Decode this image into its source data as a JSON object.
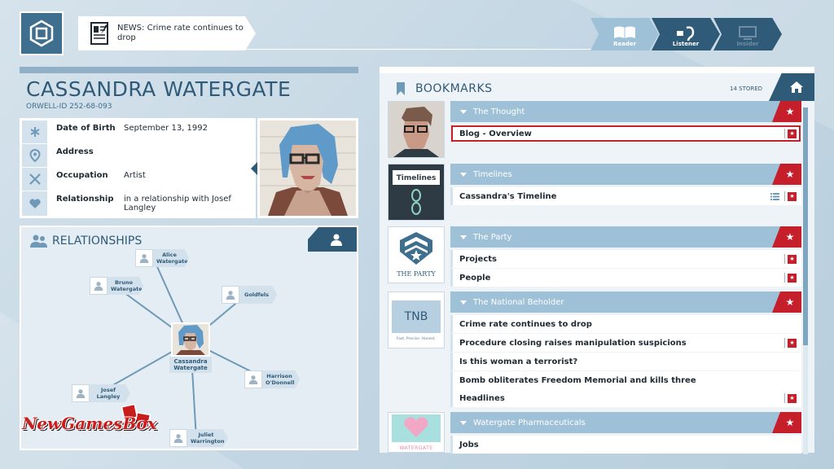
{
  "news": {
    "text": "NEWS: Crime rate continues to drop"
  },
  "modes": [
    {
      "label": "Reader",
      "active": true
    },
    {
      "label": "Listener",
      "active": false
    },
    {
      "label": "Insider",
      "active": false
    }
  ],
  "profile": {
    "name": "CASSANDRA WATERGATE",
    "id_label": "ORWELL-ID",
    "id_value": "252-68-093",
    "rows": [
      {
        "icon": "asterisk-icon",
        "label": "Date of Birth",
        "value": "September 13, 1992"
      },
      {
        "icon": "location-pin-icon",
        "label": "Address",
        "value": ""
      },
      {
        "icon": "tools-icon",
        "label": "Occupation",
        "value": "Artist"
      },
      {
        "icon": "heart-icon",
        "label": "Relationship",
        "value": "in a relationship with Josef Langley"
      }
    ]
  },
  "relationships": {
    "title": "RELATIONSHIPS",
    "center": {
      "name": "Cassandra Watergate"
    },
    "people": [
      {
        "name": "Alice Watergate"
      },
      {
        "name": "Bruno Watergate"
      },
      {
        "name": "Goldfels"
      },
      {
        "name": "Harrison O'Donnell"
      },
      {
        "name": "Josef Langley"
      },
      {
        "name": "Juliet Warrington"
      }
    ]
  },
  "watermark": {
    "text": "NewGamesBox"
  },
  "bookmarks": {
    "title": "BOOKMARKS",
    "stored": "14 STORED",
    "groups": [
      {
        "name": "The Thought",
        "items": [
          {
            "label": "Blog - Overview",
            "selected": true
          }
        ]
      },
      {
        "name": "Timelines",
        "thumb_label": "Timelines",
        "items": [
          {
            "label": "Cassandra's Timeline",
            "selected": false
          }
        ]
      },
      {
        "name": "The Party",
        "thumb_label": "THE PARTY",
        "items": [
          {
            "label": "Projects",
            "selected": false
          },
          {
            "label": "People",
            "selected": false
          }
        ]
      },
      {
        "name": "The National Beholder",
        "thumb_label": "TNB",
        "thumb_tagline": "Fast. Precise. Honest.",
        "items": [
          {
            "label": "Crime rate continues to drop",
            "selected": false
          },
          {
            "label": "Procedure closing raises manipulation suspicions",
            "selected": false
          },
          {
            "label": "Is this woman a terrorist?",
            "selected": false
          },
          {
            "label": "Bomb obliterates Freedom Memorial and kills three",
            "selected": false
          },
          {
            "label": "Headlines",
            "selected": false
          }
        ]
      },
      {
        "name": "Watergate Pharmaceuticals",
        "thumb_label": "WATERGATE",
        "items": [
          {
            "label": "Jobs",
            "selected": false
          }
        ]
      }
    ]
  },
  "colors": {
    "accent_dark": "#2f5a78",
    "accent_light": "#9fc1d8",
    "star_red": "#c61f2c"
  }
}
